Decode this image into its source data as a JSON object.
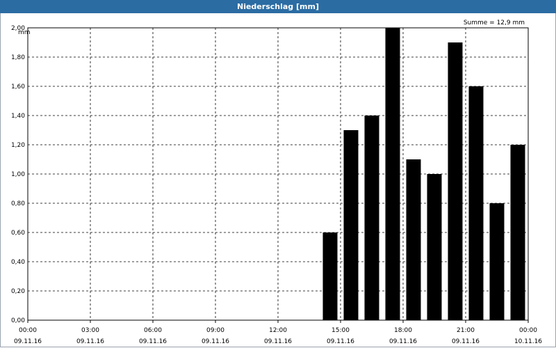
{
  "window": {
    "title": "Niederschlag [mm]"
  },
  "chart_data": {
    "type": "bar",
    "ylabel": "mm",
    "annotation": "Summe = 12,9 mm",
    "ylim": [
      0,
      2.0
    ],
    "grid": true,
    "y_ticks": [
      "0,00",
      "0,20",
      "0,40",
      "0,60",
      "0,80",
      "1,00",
      "1,20",
      "1,40",
      "1,60",
      "1,80",
      "2,00"
    ],
    "x_ticks": [
      {
        "time": "00:00",
        "date": "09.11.16"
      },
      {
        "time": "03:00",
        "date": "09.11.16"
      },
      {
        "time": "06:00",
        "date": "09.11.16"
      },
      {
        "time": "09:00",
        "date": "09.11.16"
      },
      {
        "time": "12:00",
        "date": "09.11.16"
      },
      {
        "time": "15:00",
        "date": "09.11.16"
      },
      {
        "time": "18:00",
        "date": "09.11.16"
      },
      {
        "time": "21:00",
        "date": "09.11.16"
      },
      {
        "time": "00:00",
        "date": "10.11.16"
      }
    ],
    "x_range_hours": [
      0,
      24
    ],
    "bars": [
      {
        "hour": 14.5,
        "value": 0.6
      },
      {
        "hour": 15.5,
        "value": 1.3
      },
      {
        "hour": 16.5,
        "value": 1.4
      },
      {
        "hour": 17.5,
        "value": 2.0
      },
      {
        "hour": 18.5,
        "value": 1.1
      },
      {
        "hour": 19.5,
        "value": 1.0
      },
      {
        "hour": 20.5,
        "value": 1.9
      },
      {
        "hour": 21.5,
        "value": 1.6
      },
      {
        "hour": 22.5,
        "value": 0.8
      },
      {
        "hour": 23.5,
        "value": 1.2
      }
    ],
    "bar_color": "#000000"
  }
}
